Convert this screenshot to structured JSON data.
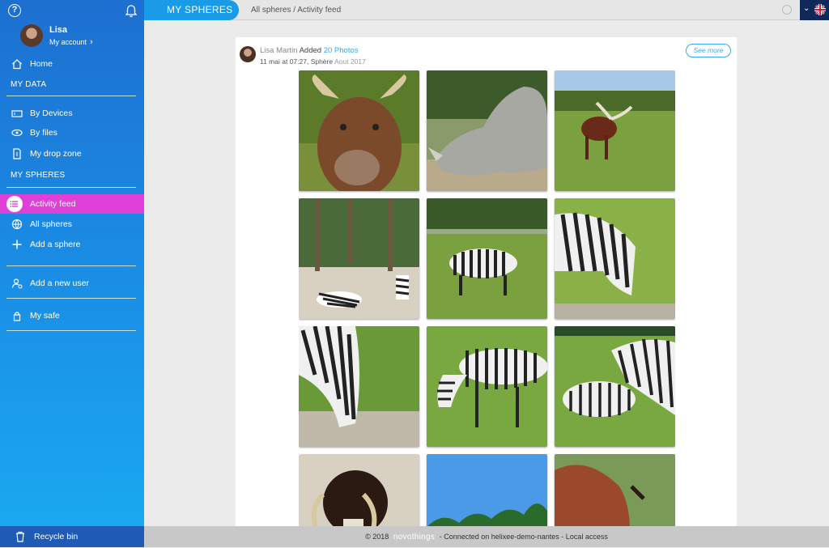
{
  "sidebar": {
    "profile": {
      "name": "Lisa",
      "account_label": "My account"
    },
    "nav": {
      "home": "Home",
      "my_data_section": "MY DATA",
      "by_devices": "By Devices",
      "by_files": "By files",
      "my_drop_zone": "My drop zone",
      "my_spheres_section": "MY SPHERES",
      "activity_feed": "Activity feed",
      "all_spheres": "All spheres",
      "add_sphere": "Add a sphere",
      "add_user": "Add a new user",
      "my_safe": "My safe"
    },
    "recycle_bin": "Recycle bin",
    "colors": {
      "gradient_top": "#1d6fd0",
      "gradient_bottom": "#1aa8f0",
      "active": "#e040d8"
    }
  },
  "topbar": {
    "tab_label": "MY SPHERES",
    "breadcrumb": "All spheres / Activity feed",
    "accent": "#1a9be8"
  },
  "post": {
    "author": "Lisa Martin",
    "verb": "Added",
    "count_label": "20 Photos",
    "timestamp": "11 mai at 07:27, Sphère",
    "album": "Aout 2017",
    "see_more": "See more",
    "photos": [
      {
        "name": "photo-buffalo"
      },
      {
        "name": "photo-rhino"
      },
      {
        "name": "photo-ankole-cattle"
      },
      {
        "name": "photo-zebras-resting"
      },
      {
        "name": "photo-zebras-grazing"
      },
      {
        "name": "photo-zebras-closeup"
      },
      {
        "name": "photo-zebra-grazing-closeup"
      },
      {
        "name": "photo-zebra-pair"
      },
      {
        "name": "photo-zebra-foal"
      },
      {
        "name": "photo-goat"
      },
      {
        "name": "photo-trees-sky"
      },
      {
        "name": "photo-antelope"
      }
    ]
  },
  "footer": {
    "copyright": "© 2018",
    "brand": "novothings",
    "status": "- Connected on helixee-demo-nantes - Local access"
  }
}
